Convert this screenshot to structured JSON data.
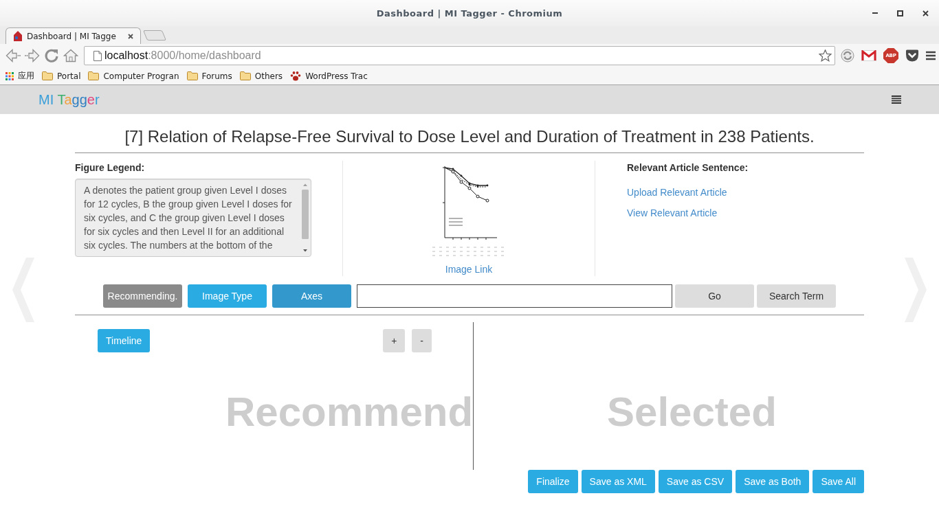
{
  "window": {
    "title": "Dashboard | MI Tagger - Chromium"
  },
  "tabs": [
    {
      "label": "Dashboard | MI Tagge",
      "selected": true
    }
  ],
  "address_bar": {
    "host": "localhost",
    "path": ":8000/home/dashboard"
  },
  "extensions": [
    {
      "kind": "sync"
    },
    {
      "kind": "mail"
    },
    {
      "kind": "adblock",
      "label": "ABP"
    },
    {
      "kind": "pocket"
    }
  ],
  "bookmarks": [
    {
      "kind": "apps",
      "label": "应用"
    },
    {
      "kind": "folder",
      "label": "Portal"
    },
    {
      "kind": "folder",
      "label": "Computer Progran"
    },
    {
      "kind": "folder",
      "label": "Forums"
    },
    {
      "kind": "folder",
      "label": "Others"
    },
    {
      "kind": "site",
      "label": "WordPress Trac"
    }
  ],
  "navbar": {
    "brand": [
      {
        "text": "MI ",
        "color": "#3a9fd9"
      },
      {
        "text": "T",
        "color": "#3cae6b"
      },
      {
        "text": "a",
        "color": "#f2a03d"
      },
      {
        "text": "gg",
        "color": "#2f7fc1"
      },
      {
        "text": "e",
        "color": "#e2467f"
      },
      {
        "text": "r",
        "color": "#3a9fd9"
      }
    ]
  },
  "figure": {
    "title": "[7] Relation of Relapse-Free Survival to Dose Level and Duration of Treatment in 238 Patients.",
    "legend_label": "Figure Legend:",
    "legend": "A denotes the patient group given Level I doses for 12 cycles, B the group given Level I doses for six cycles, and C the group given Level I doses for six cycles and then Level II for an additional six cycles. The numbers at the bottom of the",
    "image_link": "Image Link"
  },
  "article": {
    "label": "Relevant Article Sentence:",
    "links": [
      "Upload Relevant Article",
      "View Relevant Article"
    ]
  },
  "toolbar": {
    "mode_buttons": [
      {
        "label": "Recommending.",
        "disabled": true,
        "selected": false
      },
      {
        "label": "Image Type",
        "disabled": false,
        "selected": false
      },
      {
        "label": "Axes",
        "disabled": false,
        "selected": true
      }
    ],
    "actions": [
      "Go",
      "Search Term"
    ]
  },
  "recommend_panel": {
    "buttons": [
      "Timeline"
    ],
    "zoom_buttons": [
      "+",
      "-"
    ],
    "background_label": "Recommend"
  },
  "selected_panel": {
    "background_label": "Selected"
  },
  "footer_buttons": [
    "Finalize",
    "Save as XML",
    "Save as CSV",
    "Save as Both",
    "Save All"
  ]
}
